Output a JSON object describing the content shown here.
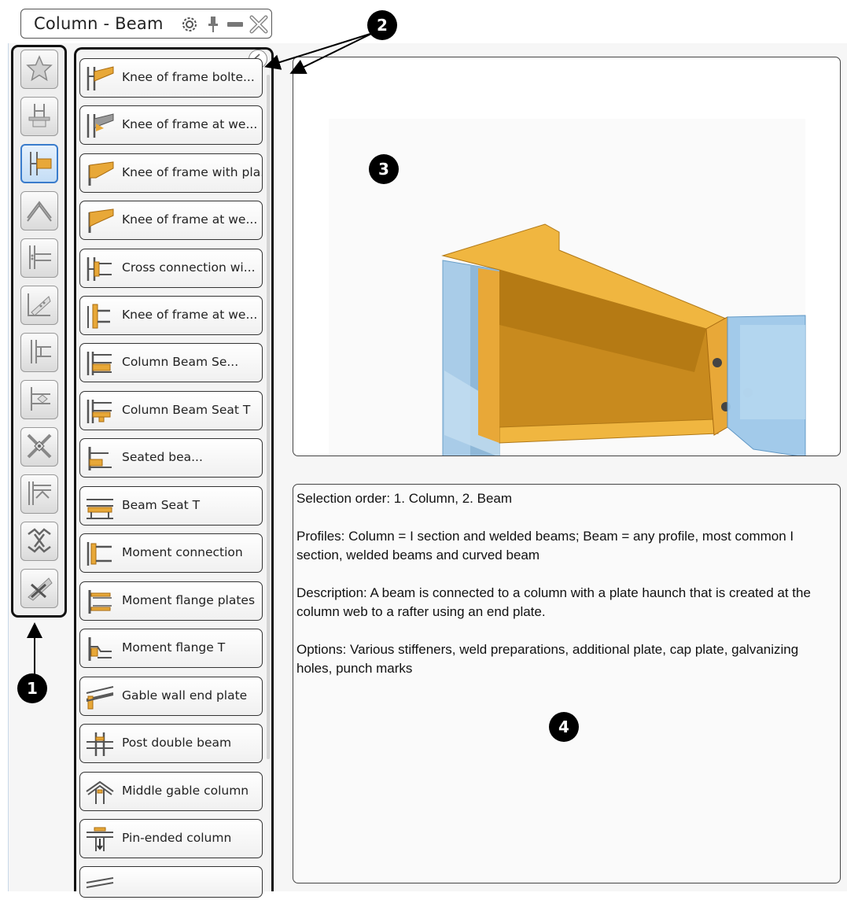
{
  "window": {
    "title": "Column - Beam"
  },
  "categories": [
    {
      "icon": "star-icon",
      "selected": false
    },
    {
      "icon": "base-plate-icon",
      "selected": false
    },
    {
      "icon": "column-beam-icon",
      "selected": true
    },
    {
      "icon": "apex-icon",
      "selected": false
    },
    {
      "icon": "beam-beam-icon",
      "selected": false
    },
    {
      "icon": "bracing-icon",
      "selected": false
    },
    {
      "icon": "shear-connection-icon",
      "selected": false
    },
    {
      "icon": "beam-splice-icon",
      "selected": false
    },
    {
      "icon": "cross-bracing-icon",
      "selected": false
    },
    {
      "icon": "frame-icon",
      "selected": false
    },
    {
      "icon": "tube-connection-icon",
      "selected": false
    },
    {
      "icon": "disabled-connection-icon",
      "selected": false
    }
  ],
  "connections": [
    {
      "label": "Knee of frame bolte...",
      "icon": "knee-frame-bolted-icon"
    },
    {
      "label": "Knee of frame at we...",
      "icon": "knee-frame-web-icon"
    },
    {
      "label": "Knee of frame with pla...",
      "icon": "knee-frame-plate-icon"
    },
    {
      "label": "Knee of frame at we...",
      "icon": "knee-frame-web-icon"
    },
    {
      "label": "Cross connection wi...",
      "icon": "cross-connection-icon"
    },
    {
      "label": "Knee of frame at we...",
      "icon": "knee-frame-web-icon"
    },
    {
      "label": "Column Beam Se...",
      "icon": "column-beam-seat-icon"
    },
    {
      "label": "Column Beam Seat T",
      "icon": "column-beam-seat-t-icon"
    },
    {
      "label": "Seated bea...",
      "icon": "seated-beam-icon"
    },
    {
      "label": "Beam Seat T",
      "icon": "beam-seat-t-icon"
    },
    {
      "label": "Moment connection",
      "icon": "moment-connection-icon"
    },
    {
      "label": "Moment flange plates",
      "icon": "moment-flange-plates-icon"
    },
    {
      "label": "Moment flange T",
      "icon": "moment-flange-t-icon"
    },
    {
      "label": "Gable wall end plate",
      "icon": "gable-wall-end-plate-icon"
    },
    {
      "label": "Post double beam",
      "icon": "post-double-beam-icon"
    },
    {
      "label": "Middle gable column",
      "icon": "middle-gable-column-icon"
    },
    {
      "label": "Pin-ended column",
      "icon": "pin-ended-column-icon"
    },
    {
      "label": "",
      "icon": "pin-ended-beam-icon"
    }
  ],
  "description": {
    "selection_order": "Selection order: 1. Column, 2. Beam",
    "profiles": "Profiles: Column = I section and welded beams; Beam = any profile, most common I section, welded beams and curved beam",
    "description": "Description: A beam is connected to a column with a plate haunch that is created at the column web to a rafter using an end plate.",
    "options": "Options: Various stiffeners, weld preparations, additional plate, cap plate, galvanizing holes, punch marks"
  },
  "callouts": [
    "1",
    "2",
    "3",
    "4"
  ],
  "colors": {
    "steel_orange": "#e8a838",
    "steel_blue": "#8fc4e8",
    "selection_blue": "#3a7ccc"
  }
}
